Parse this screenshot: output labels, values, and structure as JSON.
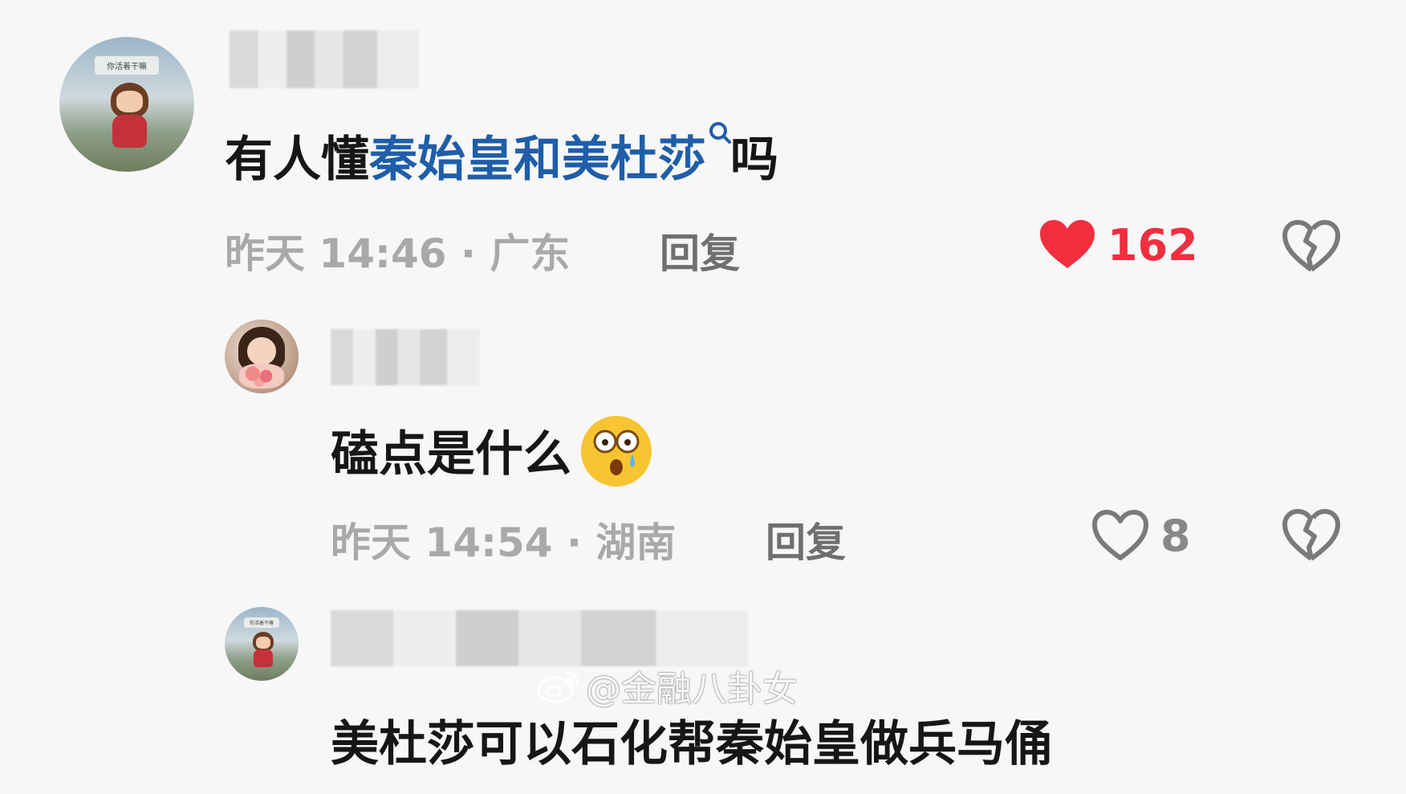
{
  "comments": [
    {
      "avatar_sign": "你活着干嘛",
      "text_prefix": "有人懂",
      "text_link": "秦始皇和美杜莎",
      "text_suffix": "吗",
      "meta": "昨天 14:46 · 广东",
      "reply_label": "回复",
      "likes": "162",
      "liked": true
    },
    {
      "text": "磕点是什么",
      "emoji": "astonished-face-emoji",
      "meta": "昨天 14:54 · 湖南",
      "reply_label": "回复",
      "likes": "8",
      "liked": false
    },
    {
      "avatar_sign": "你活着干嘛",
      "text": "美杜莎可以石化帮秦始皇做兵马俑"
    }
  ],
  "watermark": "@金融八卦女",
  "colors": {
    "link": "#1f5ea8",
    "like_active": "#f02e3e",
    "meta_gray": "#a9a9a9"
  }
}
